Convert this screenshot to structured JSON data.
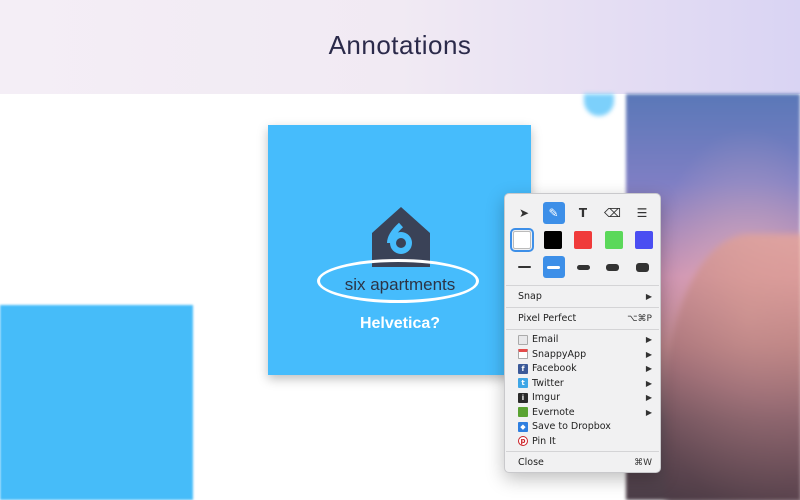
{
  "header": {
    "title": "Annotations"
  },
  "card": {
    "brand_name": "six apartments",
    "note": "Helvetica?",
    "bg_color": "#46bcfc"
  },
  "panel": {
    "tools": [
      {
        "name": "pointer-tool",
        "glyph": "➤",
        "active": false
      },
      {
        "name": "highlighter-tool",
        "glyph": "✎",
        "active": true
      },
      {
        "name": "text-tool",
        "glyph": "T",
        "active": false
      },
      {
        "name": "eraser-tool",
        "glyph": "⌫",
        "active": false
      },
      {
        "name": "adjust-tool",
        "glyph": "☰",
        "active": false
      }
    ],
    "colors": [
      "#ffffff",
      "#000000",
      "#f03a3a",
      "#5bd85a",
      "#4a4ef2"
    ],
    "selected_color": "#ffffff",
    "line_widths_count": 5,
    "selected_line": 1,
    "snap_label": "Snap",
    "pixel_perfect_label": "Pixel Perfect",
    "pixel_perfect_shortcut": "⌥⌘P",
    "share_items": [
      {
        "label": "Email",
        "icon": "email-icon",
        "color": "#e8e8ea",
        "submenu": true
      },
      {
        "label": "SnappyApp",
        "icon": "snappyapp-icon",
        "color": "#e44c4c",
        "submenu": true
      },
      {
        "label": "Facebook",
        "icon": "facebook-icon",
        "color": "#3b5998",
        "submenu": true
      },
      {
        "label": "Twitter",
        "icon": "twitter-icon",
        "color": "#3ea6e6",
        "submenu": true
      },
      {
        "label": "Imgur",
        "icon": "imgur-icon",
        "color": "#2b2b2b",
        "submenu": true
      },
      {
        "label": "Evernote",
        "icon": "evernote-icon",
        "color": "#5aa332",
        "submenu": true
      },
      {
        "label": "Save to Dropbox",
        "icon": "dropbox-icon",
        "color": "#2f7fe0",
        "submenu": false
      },
      {
        "label": "Pin It",
        "icon": "pinterest-icon",
        "color": "#cc2127",
        "submenu": false
      }
    ],
    "close_label": "Close",
    "close_shortcut": "⌘W",
    "accent": "#3d8fe8"
  }
}
